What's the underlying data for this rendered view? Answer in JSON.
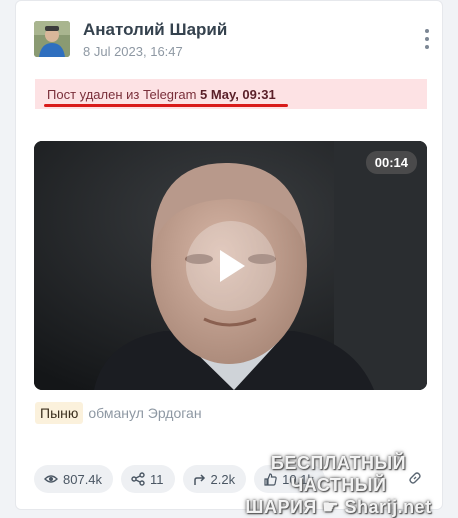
{
  "post": {
    "author": "Анатолий Шарий",
    "date": "8 Jul 2023, 16:47",
    "notice_text": "Пост удален из Telegram ",
    "notice_date": "5 May, 09:31",
    "video_duration": "00:14",
    "caption_tag": "Пыню",
    "caption_text": "обманул Эрдоган"
  },
  "stats": {
    "views": "807.4k",
    "shares": "11",
    "forwards": "2.2k",
    "likes": "10.1k"
  },
  "icons": {
    "menu": "kebab-menu-icon",
    "play": "play-icon",
    "views": "eye-icon",
    "shares": "share-icon",
    "forwards": "forward-icon",
    "likes": "thumbs-up-icon",
    "link": "link-icon"
  },
  "watermark": {
    "line1": "БЕСПЛАТНЫЙ ЧАСТНЫЙ",
    "line2": "ШАРИЯ",
    "line3": "Sharij.net"
  },
  "colors": {
    "notice_bg": "#fde2e4",
    "underline": "#d91a1a",
    "tag_bg": "#fbf1dc"
  }
}
